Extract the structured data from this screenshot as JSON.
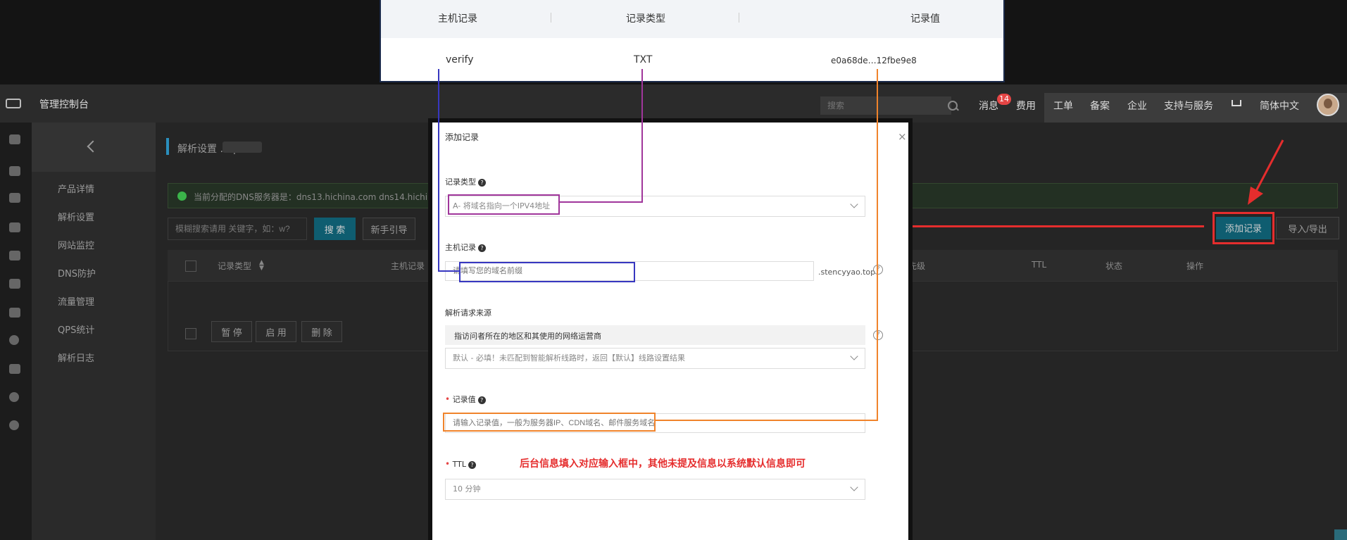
{
  "callout": {
    "headers": [
      "主机记录",
      "记录类型",
      "记录值"
    ],
    "row": [
      "verify",
      "TXT",
      "e0a68de…12fbe9e8"
    ]
  },
  "navbar": {
    "console_title": "管理控制台",
    "search_placeholder": "搜索",
    "messages": "消息",
    "message_count": "14",
    "items": [
      "费用",
      "工单",
      "备案",
      "企业",
      "支持与服务",
      "简体中文"
    ]
  },
  "sidebar": {
    "items": [
      "产品详情",
      "解析设置",
      "网站监控",
      "DNS防护",
      "流量管理",
      "QPS统计",
      "解析日志"
    ]
  },
  "main": {
    "breadcrumb": "解析设置          .top",
    "dns_servers": "当前分配的DNS服务器是：dns13.hichina.com  dns14.hichina.com",
    "filter_placeholder": "模糊搜索请用 关键字，如：w?",
    "search_button": "搜 索",
    "guide_button": "新手引导",
    "add_record_button": "添加记录",
    "import_export_button": "导入/导出",
    "table_headers": [
      "记录类型",
      "主机记录",
      "先级",
      "TTL",
      "状态",
      "操作"
    ],
    "bulk_buttons": [
      "暂 停",
      "启 用",
      "删 除"
    ]
  },
  "modal": {
    "title": "添加记录",
    "close": "×",
    "record_type_label": "记录类型",
    "record_type_value": "A- 将域名指向一个IPV4地址",
    "host_label": "主机记录",
    "host_placeholder": "请填写您的域名前缀",
    "host_suffix": ".stencyyao.top",
    "source_label": "解析请求来源",
    "source_hint": "指访问者所在的地区和其使用的网络运营商",
    "source_value": "默认 - 必填！未匹配到智能解析线路时，返回【默认】线路设置结果",
    "value_label": "记录值",
    "value_placeholder": "请输入记录值，一般为服务器IP、CDN域名、邮件服务域名",
    "ttl_label": "TTL",
    "ttl_value": "10 分钟",
    "annotation": "后台信息填入对应输入框中，其他未提及信息以系统默认信息即可"
  },
  "colors": {
    "highlight_purple": "#a0369b",
    "highlight_blue": "#3737c0",
    "highlight_orange": "#f0832b",
    "arrow_red": "#e52d2d",
    "accent_teal": "#0f5d70"
  }
}
